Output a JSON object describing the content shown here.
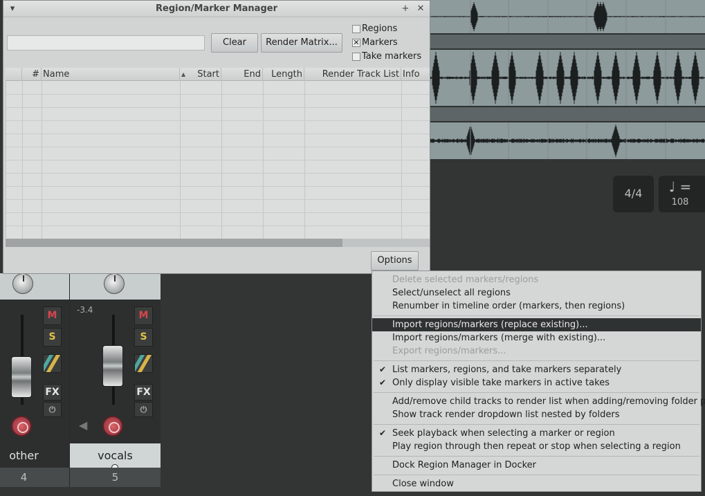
{
  "window": {
    "title": "Region/Marker Manager",
    "search_value": "",
    "clear_button": "Clear",
    "render_matrix_button": "Render Matrix...",
    "options_button": "Options",
    "checkboxes": [
      {
        "label": "Regions",
        "checked": false
      },
      {
        "label": "Markers",
        "checked": true
      },
      {
        "label": "Take markers",
        "checked": false
      }
    ],
    "columns": [
      "#",
      "Name",
      "Start",
      "End",
      "Length",
      "Render Track List",
      "Info"
    ]
  },
  "menu": {
    "items": [
      {
        "label": "Delete selected markers/regions",
        "disabled": true,
        "checked": false
      },
      {
        "label": "Select/unselect all regions",
        "disabled": false,
        "checked": false
      },
      {
        "label": "Renumber in timeline order (markers, then regions)",
        "disabled": false,
        "checked": false
      },
      {
        "label": "Import regions/markers (replace existing)...",
        "disabled": false,
        "checked": false,
        "highlighted": true
      },
      {
        "label": "Import regions/markers (merge with existing)...",
        "disabled": false,
        "checked": false
      },
      {
        "label": "Export regions/markers...",
        "disabled": true,
        "checked": false
      },
      {
        "label": "List markers, regions, and take markers separately",
        "disabled": false,
        "checked": true
      },
      {
        "label": "Only display visible take markers in active takes",
        "disabled": false,
        "checked": true
      },
      {
        "label": "Add/remove child tracks to render list when adding/removing folder parent",
        "disabled": false,
        "checked": false
      },
      {
        "label": "Show track render dropdown list nested by folders",
        "disabled": false,
        "checked": false
      },
      {
        "label": "Seek playback when selecting a marker or region",
        "disabled": false,
        "checked": true
      },
      {
        "label": "Play region through then repeat or stop when selecting a region",
        "disabled": false,
        "checked": false
      },
      {
        "label": "Dock Region Manager in Docker",
        "disabled": false,
        "checked": false
      },
      {
        "label": "Close window",
        "disabled": false,
        "checked": false
      }
    ]
  },
  "transport": {
    "time_signature": "4/4",
    "tempo_symbol": "♩ =",
    "tempo": "108"
  },
  "mixer": {
    "strips": [
      {
        "name": "other",
        "number": "4",
        "volume_readout": "",
        "mute": "M",
        "solo": "S",
        "fx": "FX"
      },
      {
        "name": "vocals",
        "number": "5",
        "volume_readout": "-3.4",
        "mute": "M",
        "solo": "S",
        "fx": "FX"
      }
    ]
  },
  "colors": {
    "menu_highlight": "#2f3232",
    "waveform_lane": "#8e9b9d",
    "mute_text": "#d8454d",
    "solo_text": "#e0c34a"
  }
}
